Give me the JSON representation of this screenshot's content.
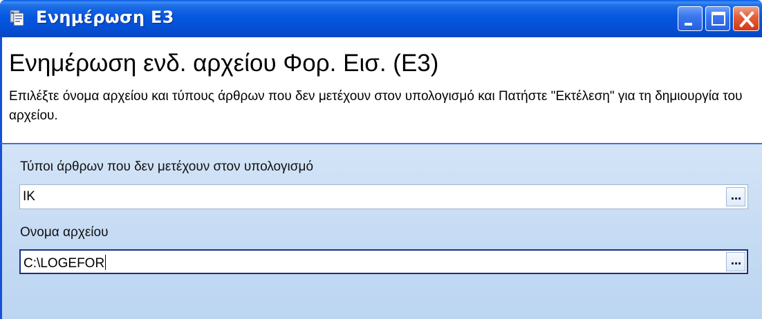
{
  "window": {
    "title": "Ενημέρωση Ε3",
    "controls": {
      "minimize": "minimize-icon",
      "maximize": "maximize-icon",
      "close": "close-icon"
    }
  },
  "header": {
    "title": "Ενημέρωση ενδ. αρχείου Φορ. Εισ. (Ε3)",
    "description": "Επιλέξτε όνομα αρχείου και τύπους άρθρων που δεν μετέχουν στον υπολογισμό και Πατήστε \"Εκτέλεση\" για τη δημιουργία του αρχείου."
  },
  "form": {
    "excluded_types": {
      "label": "Τύποι άρθρων που δεν μετέχουν στον υπολογισμό",
      "value": "ΙΚ",
      "browse_label": "..."
    },
    "file_name": {
      "label": "Ονομα αρχείου",
      "value": "C:\\LOGEFOR",
      "browse_label": "..."
    }
  },
  "colors": {
    "titlebar": "#0557e0",
    "panel": "#c4daf3",
    "focus_border": "#1b2f80",
    "close_button": "#e5603c"
  }
}
